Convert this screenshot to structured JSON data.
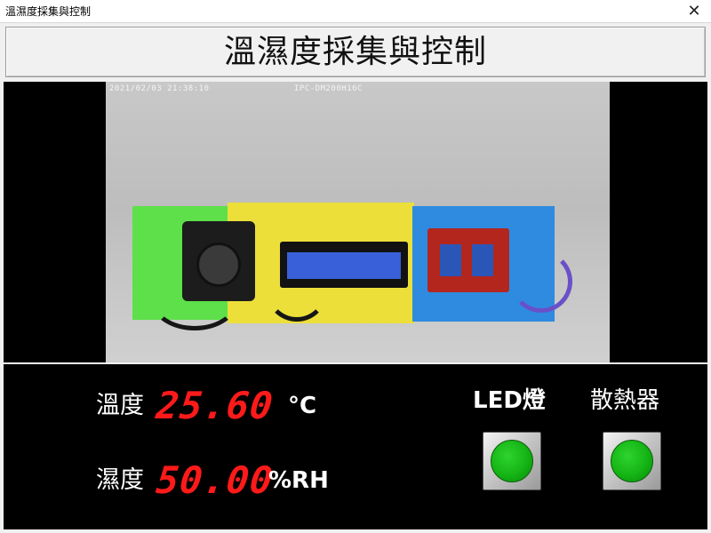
{
  "window": {
    "title": "溫濕度採集與控制",
    "close_symbol": "✕"
  },
  "header": {
    "title": "溫濕度採集與控制"
  },
  "camera": {
    "timestamp": "2021/02/03  21:38:10",
    "camera_name": "IPC-DM200H16C"
  },
  "readings": {
    "temperature": {
      "label": "溫度",
      "value": "25.60",
      "unit": "°C"
    },
    "humidity": {
      "label": "濕度",
      "value": "50.00",
      "unit": "%RH"
    }
  },
  "controls": {
    "led": {
      "label": "LED燈",
      "state": "on",
      "color": "#14b414"
    },
    "fan": {
      "label": "散熱器",
      "state": "on",
      "color": "#14b414"
    }
  },
  "colors": {
    "value_red": "#ff1a1a",
    "panel_bg": "#000000",
    "indicator_green": "#14b414"
  }
}
